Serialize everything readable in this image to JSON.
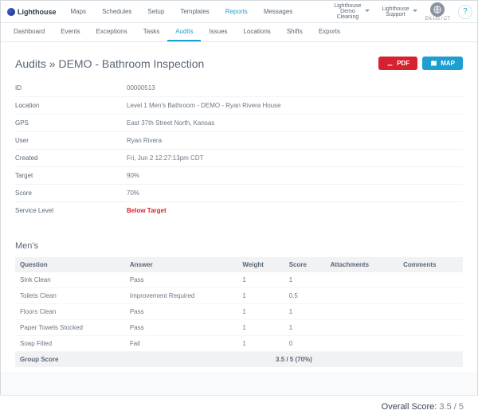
{
  "brand": "Lighthouse",
  "topnav": [
    "Maps",
    "Schedules",
    "Setup",
    "Templates",
    "Reports",
    "Messages"
  ],
  "topnav_active_index": 4,
  "topnav_dropdowns": [
    "Lighthouse Demo Cleaning",
    "Lighthouse Support"
  ],
  "locale_label": "EN-US / CT",
  "subnav": [
    "Dashboard",
    "Events",
    "Exceptions",
    "Tasks",
    "Audits",
    "Issues",
    "Locations",
    "Shifts",
    "Exports"
  ],
  "subnav_active_index": 4,
  "page_title": "Audits » DEMO - Bathroom Inspection",
  "buttons": {
    "pdf": "PDF",
    "map": "MAP"
  },
  "details": [
    {
      "label": "ID",
      "value": "00000513"
    },
    {
      "label": "Location",
      "value": "Level 1 Men's Bathroom - DEMO - Ryan Rivera House"
    },
    {
      "label": "GPS",
      "value": "East 37th Street North, Kansas"
    },
    {
      "label": "User",
      "value": "Ryan Rivera"
    },
    {
      "label": "Created",
      "value": "Fri, Jun 2 12:27:13pm CDT"
    },
    {
      "label": "Target",
      "value": "90%"
    },
    {
      "label": "Score",
      "value": "70%"
    },
    {
      "label": "Service Level",
      "value": "Below Target",
      "below": true
    }
  ],
  "section_heading": "Men's",
  "table": {
    "headers": [
      "Question",
      "Answer",
      "Weight",
      "Score",
      "Attachments",
      "Comments"
    ],
    "rows": [
      {
        "q": "Sink Clean",
        "a": "Pass",
        "w": "1",
        "s": "1",
        "att": "",
        "c": ""
      },
      {
        "q": "Toilets Clean",
        "a": "Improvement Required",
        "w": "1",
        "s": "0.5",
        "att": "",
        "c": ""
      },
      {
        "q": "Floors Clean",
        "a": "Pass",
        "w": "1",
        "s": "1",
        "att": "",
        "c": ""
      },
      {
        "q": "Paper Towels Stocked",
        "a": "Pass",
        "w": "1",
        "s": "1",
        "att": "",
        "c": ""
      },
      {
        "q": "Soap Filled",
        "a": "Fail",
        "w": "1",
        "s": "0",
        "att": "",
        "c": ""
      }
    ],
    "group_score_label": "Group Score",
    "group_score_value": "3.5 / 5 (70%)"
  },
  "footer": {
    "label": "Overall Score:",
    "value": "3.5 / 5"
  }
}
